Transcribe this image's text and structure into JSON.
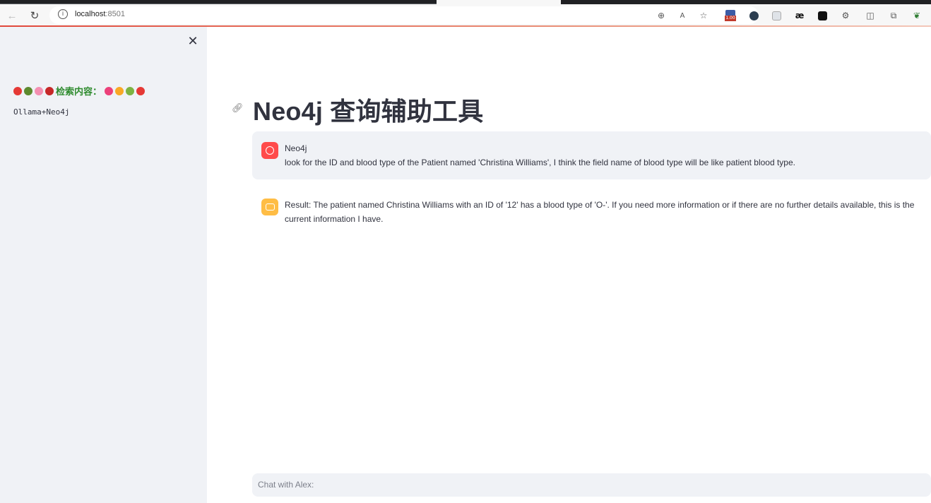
{
  "browser": {
    "url_host": "localhost",
    "url_port": ":8501",
    "toolbar_icons": [
      "back-icon",
      "reload-icon",
      "info-icon",
      "zoom-icon",
      "read-aloud-icon",
      "favorite-star-icon",
      "extension-badge-icon",
      "extension-dot-icon",
      "extension-page-icon",
      "extension-ae-icon",
      "extension-game-icon",
      "extension-gear-icon",
      "split-screen-icon",
      "collections-icon",
      "extension-leaf-icon"
    ],
    "badge_text": "1.00",
    "ae_label": "æ"
  },
  "sidebar": {
    "close_label": "✕",
    "heading_label": "检索内容：",
    "content": "Ollama+Neo4j"
  },
  "main": {
    "title": "Neo4j 查询辅助工具",
    "messages": [
      {
        "role": "user",
        "avatar_icon": "user-face-icon",
        "author": "Neo4j",
        "text": "look for the ID and blood type of the Patient named 'Christina Williams', I think the field name of blood type will be like patient blood type."
      },
      {
        "role": "assistant",
        "avatar_icon": "bot-icon",
        "text": "Result: The patient named Christina Williams with an ID of '12' has a blood type of 'O-'. If you need more information or if there are no further details available, this is the current information I have."
      }
    ],
    "chat_input": {
      "placeholder": "Chat with Alex:"
    }
  },
  "colors": {
    "sidebar_bg": "#f0f2f6",
    "user_avatar": "#ff4b4b",
    "bot_avatar": "#ffbd45",
    "sidebar_heading": "#2e8b2e"
  }
}
